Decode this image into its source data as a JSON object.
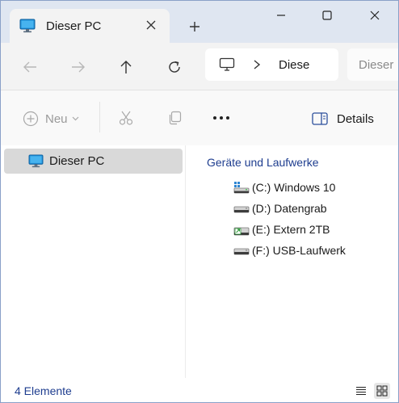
{
  "tab": {
    "title": "Dieser PC",
    "icon": "monitor-icon"
  },
  "address": {
    "segment": "Diese",
    "search_placeholder": "Dieser"
  },
  "commands": {
    "new_label": "Neu",
    "details_label": "Details"
  },
  "sidebar": {
    "items": [
      {
        "label": "Dieser PC",
        "icon": "monitor-icon"
      }
    ]
  },
  "main": {
    "group_header": "Geräte und Laufwerke",
    "drives": [
      {
        "label": "(C:) Windows 10",
        "icon": "system-drive-icon"
      },
      {
        "label": "(D:) Datengrab",
        "icon": "drive-icon"
      },
      {
        "label": "(E:) Extern 2TB",
        "icon": "external-drive-icon"
      },
      {
        "label": "(F:) USB-Laufwerk",
        "icon": "drive-icon"
      }
    ]
  },
  "status": {
    "count_text": "4 Elemente"
  },
  "colors": {
    "accent": "#1e3d8f",
    "titlebar": "#dfe6f1",
    "selection": "#d9d9d9"
  }
}
